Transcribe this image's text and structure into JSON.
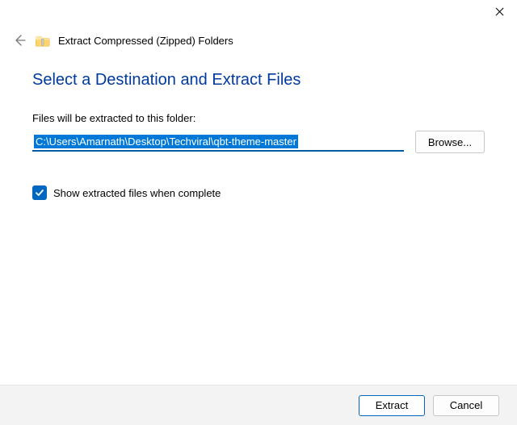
{
  "window": {
    "title": "Extract Compressed (Zipped) Folders"
  },
  "main": {
    "heading": "Select a Destination and Extract Files",
    "folder_label": "Files will be extracted to this folder:",
    "path_value": "C:\\Users\\Amarnath\\Desktop\\Techviral\\qbt-theme-master",
    "browse_label": "Browse...",
    "checkbox_label": "Show extracted files when complete",
    "checkbox_checked": true
  },
  "footer": {
    "extract_label": "Extract",
    "cancel_label": "Cancel"
  }
}
